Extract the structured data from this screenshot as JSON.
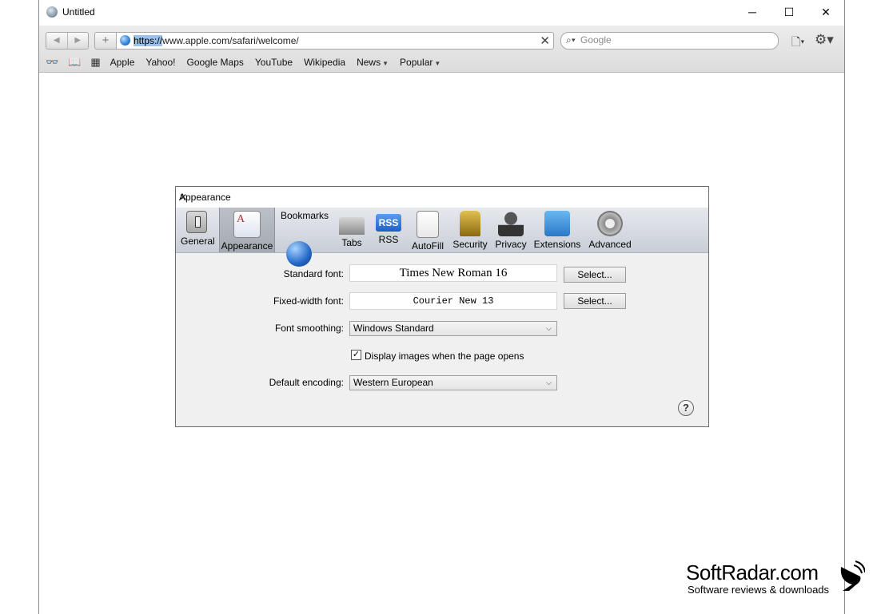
{
  "window": {
    "title": "Untitled",
    "controls": {
      "minimize": "─",
      "maximize": "☐",
      "close": "✕"
    }
  },
  "toolbar": {
    "back_glyph": "◀",
    "forward_glyph": "▶",
    "add_glyph": "+",
    "url_scheme": "https://",
    "url_rest": "www.apple.com/safari/welcome/",
    "url_clear_glyph": "✕",
    "search_placeholder": "Google",
    "search_glyph": "⌕▾",
    "page_menu_glyph": "🗋▾",
    "settings_glyph": "⚙▾"
  },
  "bookmarks_bar": {
    "icons": [
      "reading-list-icon",
      "bookmarks-book-icon",
      "top-sites-grid-icon"
    ],
    "icon_glyphs": [
      "👓",
      "📖",
      "▦"
    ],
    "items": [
      "Apple",
      "Yahoo!",
      "Google Maps",
      "YouTube",
      "Wikipedia"
    ],
    "menus": [
      "News",
      "Popular"
    ],
    "menu_caret": "▼"
  },
  "dialog": {
    "title": "Appearance",
    "close_glyph": "✕",
    "tabs": [
      {
        "label": "General",
        "icon": "general-switch-icon"
      },
      {
        "label": "Appearance",
        "icon": "appearance-font-icon",
        "active": true
      },
      {
        "label": "Bookmarks",
        "icon": "bookmarks-globe-icon"
      },
      {
        "label": "Tabs",
        "icon": "tabs-icon"
      },
      {
        "label": "RSS",
        "icon": "rss-icon",
        "icon_text": "RSS"
      },
      {
        "label": "AutoFill",
        "icon": "autofill-pen-icon"
      },
      {
        "label": "Security",
        "icon": "security-lock-icon"
      },
      {
        "label": "Privacy",
        "icon": "privacy-person-icon"
      },
      {
        "label": "Extensions",
        "icon": "extensions-puzzle-icon"
      },
      {
        "label": "Advanced",
        "icon": "advanced-gear-icon"
      }
    ],
    "standard_font_label": "Standard font:",
    "standard_font_value": "Times New Roman 16",
    "fixed_font_label": "Fixed-width font:",
    "fixed_font_value": "Courier New 13",
    "select_button": "Select...",
    "smoothing_label": "Font smoothing:",
    "smoothing_value": "Windows Standard",
    "display_images_label": "Display images when the page opens",
    "display_images_checked": true,
    "check_glyph": "✓",
    "encoding_label": "Default encoding:",
    "encoding_value": "Western European",
    "dropdown_caret": "⌵",
    "help_glyph": "?"
  },
  "watermark": {
    "title": "SoftRadar.com",
    "subtitle": "Software reviews & downloads"
  }
}
